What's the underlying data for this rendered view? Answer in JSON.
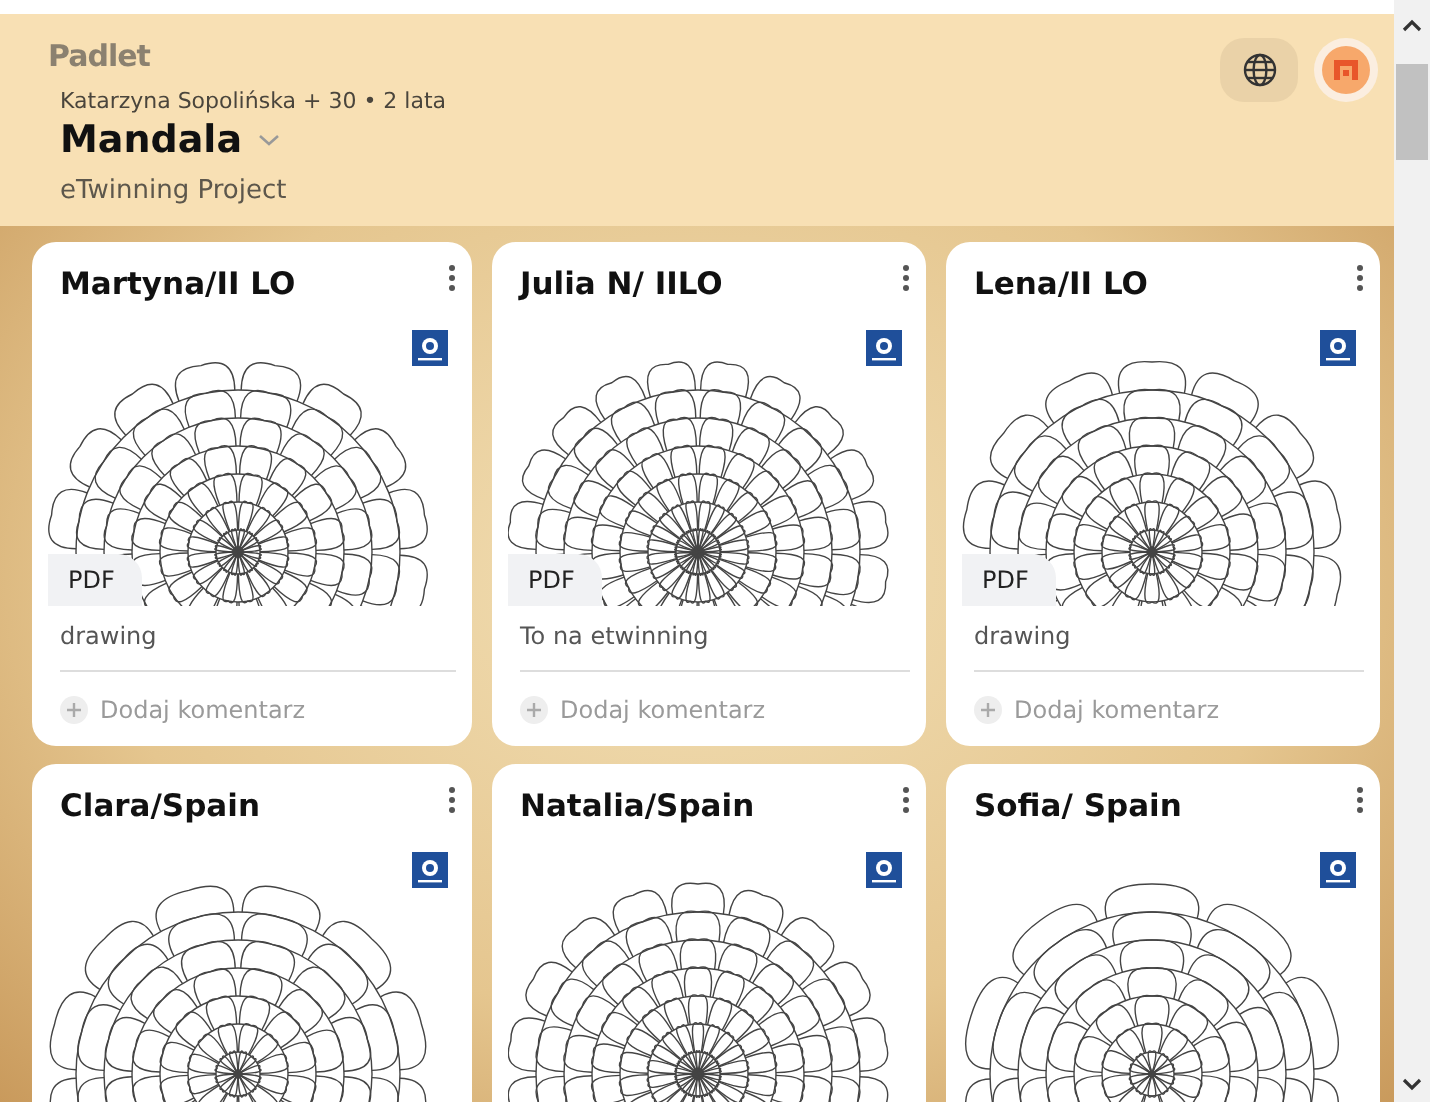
{
  "header": {
    "logo": "Padlet",
    "byline": "Katarzyna Sopolińska + 30 • 2 lata",
    "title": "Mandala",
    "subtitle": "eTwinning Project"
  },
  "cards": [
    {
      "title": "Martyna/II LO",
      "attachment_label": "PDF",
      "caption": "drawing",
      "comment_placeholder": "Dodaj komentarz"
    },
    {
      "title": "Julia N/ IILO",
      "attachment_label": "PDF",
      "caption": "To na etwinning",
      "comment_placeholder": "Dodaj komentarz"
    },
    {
      "title": "Lena/II LO",
      "attachment_label": "PDF",
      "caption": "drawing",
      "comment_placeholder": "Dodaj komentarz"
    },
    {
      "title": "Clara/Spain"
    },
    {
      "title": "Natalia/Spain"
    },
    {
      "title": "Sofia/ Spain"
    }
  ]
}
